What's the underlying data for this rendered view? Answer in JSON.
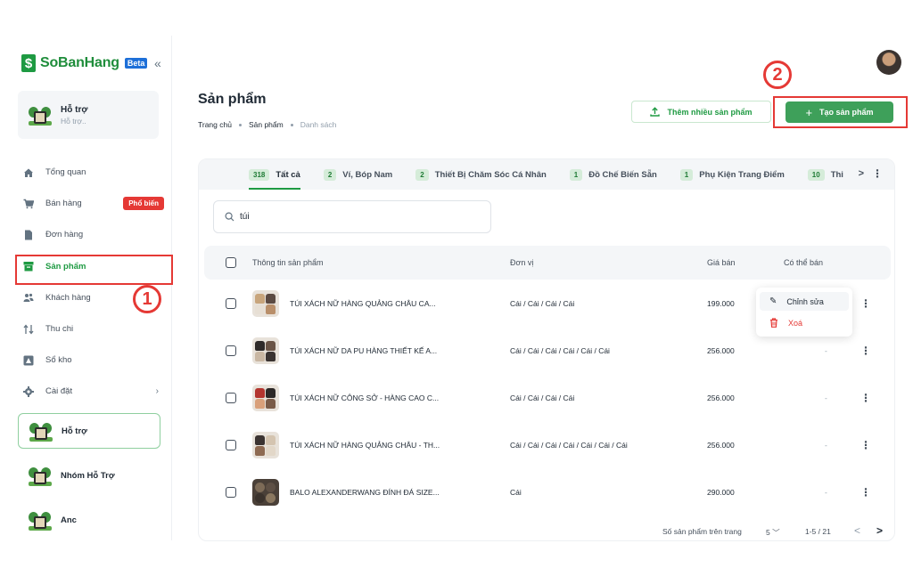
{
  "brand": {
    "logo_glyph": "$",
    "name": "SoBanHang",
    "badge": "Beta",
    "collapse_glyph": "«",
    "color": "#1e9a42"
  },
  "store": {
    "name": "Hỗ trợ",
    "sub": "Hỗ trợ.."
  },
  "nav": {
    "items": [
      {
        "label": "Tổng quan",
        "icon": "home-icon"
      },
      {
        "label": "Bán hàng",
        "icon": "cart-icon",
        "badge": "Phổ biến"
      },
      {
        "label": "Đơn hàng",
        "icon": "document-icon"
      },
      {
        "label": "Sản phẩm",
        "icon": "box-icon"
      },
      {
        "label": "Khách hàng",
        "icon": "users-icon"
      },
      {
        "label": "Thu chi",
        "icon": "transfer-icon"
      },
      {
        "label": "Sổ kho",
        "icon": "warehouse-icon"
      },
      {
        "label": "Cài đặt",
        "icon": "gear-icon"
      }
    ]
  },
  "stores": [
    {
      "label": "Hỗ trợ"
    },
    {
      "label": "Nhóm Hỗ Trợ"
    },
    {
      "label": "Anc"
    }
  ],
  "annotations": {
    "one": "1",
    "two": "2",
    "color": "#e53935"
  },
  "page": {
    "title": "Sản phẩm",
    "breadcrumb": [
      "Trang chủ",
      "Sản phẩm",
      "Danh sách"
    ]
  },
  "actions": {
    "import_label": "Thêm nhiều sản phẩm",
    "import_icon": "upload-icon",
    "create_label": "Tạo sản phẩm",
    "create_icon": "plus-icon"
  },
  "tabs": [
    {
      "count": "318",
      "label": "Tất cả"
    },
    {
      "count": "2",
      "label": "Ví, Bóp Nam"
    },
    {
      "count": "2",
      "label": "Thiết Bị Chăm Sóc Cá Nhân"
    },
    {
      "count": "1",
      "label": "Đồ Chế Biến Sẵn"
    },
    {
      "count": "1",
      "label": "Phụ Kiện Trang Điểm"
    },
    {
      "count": "10",
      "label": "Thi"
    }
  ],
  "tab_controls": {
    "next": ">",
    "more": "⋮"
  },
  "search": {
    "value": "túi",
    "icon": "search-icon"
  },
  "table": {
    "headers": {
      "info": "Thông tin sản phẩm",
      "unit": "Đơn vị",
      "price": "Giá bán",
      "available": "Có thể bán"
    },
    "rows": [
      {
        "name": "TÚI XÁCH NỮ HÀNG QUẢNG CHÂU CA...",
        "unit": "Cái / Cái / Cái / Cái",
        "price": "199.000",
        "available": "-"
      },
      {
        "name": "TÚI XÁCH NỮ DA PU HÀNG THIẾT KẾ A...",
        "unit": "Cái / Cái / Cái / Cái / Cái / Cái",
        "price": "256.000",
        "available": "-"
      },
      {
        "name": "TÚI XÁCH NỮ CÔNG SỞ - HÀNG CAO C...",
        "unit": "Cái / Cái / Cái / Cái",
        "price": "256.000",
        "available": "-"
      },
      {
        "name": "TÚI XÁCH NỮ HÀNG QUẢNG CHÂU - TH...",
        "unit": "Cái / Cái / Cái / Cái / Cái / Cái / Cái",
        "price": "256.000",
        "available": "-"
      },
      {
        "name": "BALO ALEXANDERWANG ĐÍNH ĐÁ SIZE...",
        "unit": "Cái",
        "price": "290.000",
        "available": "-"
      }
    ]
  },
  "context_menu": {
    "edit": "Chỉnh sửa",
    "delete": "Xoá"
  },
  "pagination": {
    "per_page_label": "Số sản phẩm trên trang",
    "per_page": "5",
    "range": "1-5 / 21",
    "prev": "<",
    "next": ">"
  }
}
